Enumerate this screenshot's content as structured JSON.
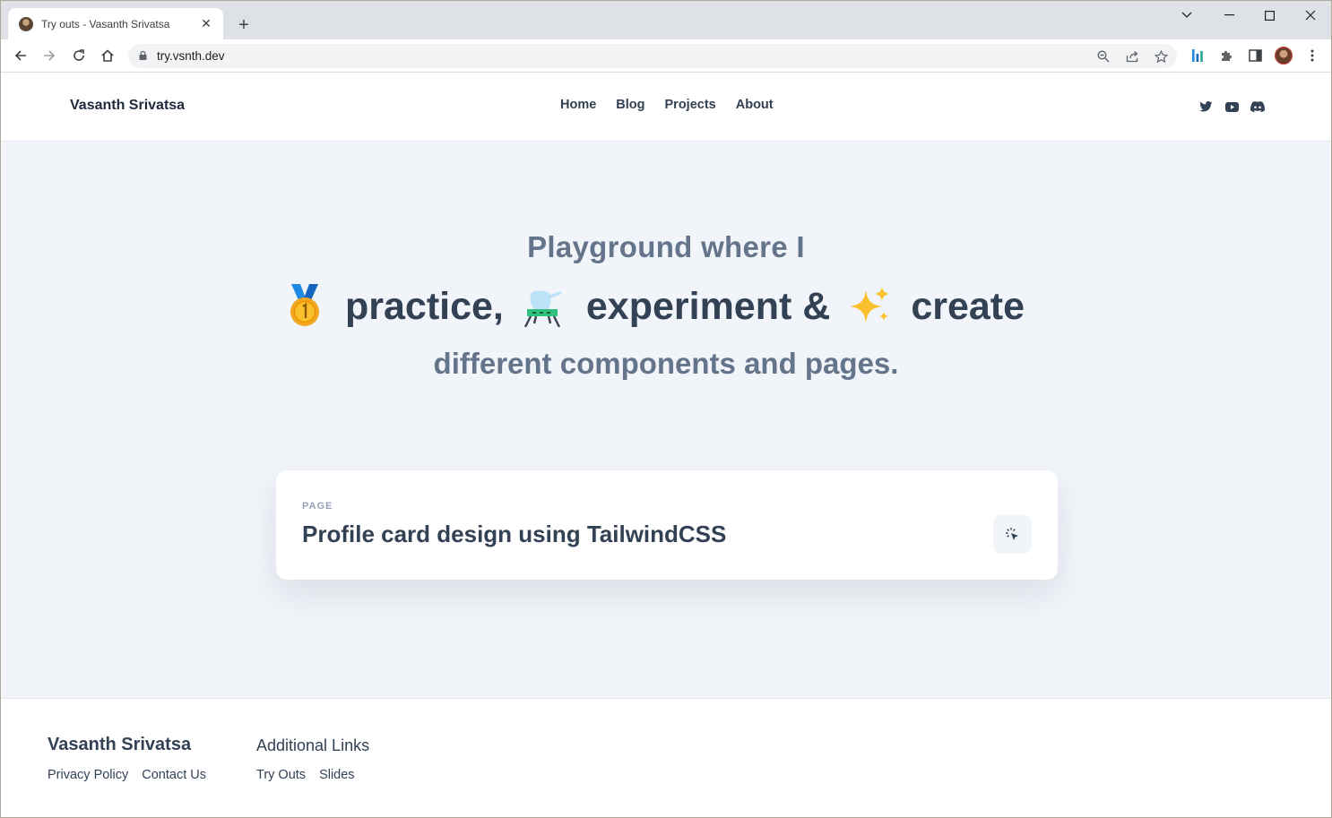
{
  "browser": {
    "tab_title": "Try outs - Vasanth Srivatsa",
    "url": "try.vsnth.dev"
  },
  "header": {
    "brand": "Vasanth Srivatsa",
    "nav": [
      "Home",
      "Blog",
      "Projects",
      "About"
    ]
  },
  "hero": {
    "line1": "Playground where I",
    "word1": "practice,",
    "word2": "experiment &",
    "word3": "create",
    "line3": "different components and pages."
  },
  "card": {
    "kicker": "PAGE",
    "title": "Profile card design using TailwindCSS"
  },
  "footer": {
    "col1_title": "Vasanth Srivatsa",
    "col1_links": [
      "Privacy Policy",
      "Contact Us"
    ],
    "col2_title": "Additional Links",
    "col2_links": [
      "Try Outs",
      "Slides"
    ]
  },
  "colors": {
    "page_bg": "#f1f4f9",
    "text_dark": "#334155",
    "text_muted": "#64748b"
  }
}
